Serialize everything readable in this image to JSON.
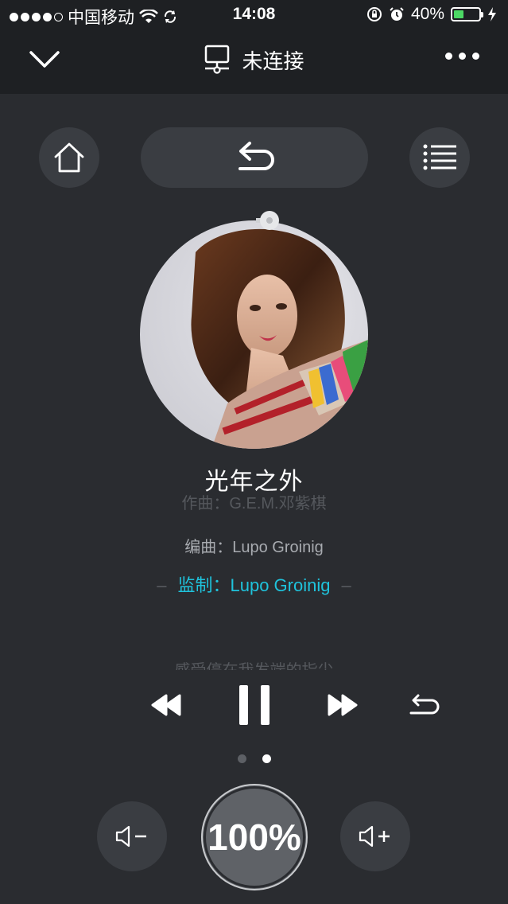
{
  "status_bar": {
    "carrier": "中国移动",
    "time": "14:08",
    "battery_percent": "40%"
  },
  "header": {
    "connection_status": "未连接"
  },
  "song": {
    "title": "光年之外"
  },
  "lyrics": {
    "composer_line": "作曲：G.E.M.邓紫棋",
    "arranger_line": "编曲：Lupo Groinig",
    "producer_line": "监制：Lupo Groinig",
    "next_line": "感受停在我发端的指尖"
  },
  "volume": {
    "level": "100%",
    "value_fraction": 1.0
  },
  "pager": {
    "pages": 2,
    "current": 2
  },
  "colors": {
    "background": "#2a2c30",
    "header_bg": "#1e2023",
    "button_bg": "#3a3d42",
    "accent_lyric": "#1fc3dc",
    "battery": "#4cd964"
  }
}
